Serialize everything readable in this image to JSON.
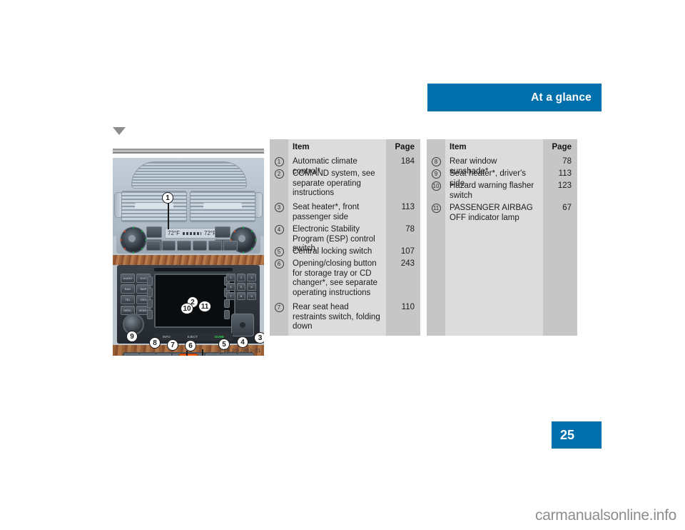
{
  "header": {
    "section_title": "At a glance"
  },
  "page_number": "25",
  "figure": {
    "caption": "P68.20-2851-31",
    "marker": "down-triangle",
    "climate_display_left": "72°F",
    "climate_display_right": "72°F",
    "comand_buttons_left": [
      "AUDIO",
      "RAD",
      "TEL",
      "SEEK-"
    ],
    "comand_buttons_left2": [
      "EXIT",
      "MAP",
      "GEO",
      "SEEK+"
    ],
    "comand_keypad": [
      "1",
      "2",
      "3",
      "4",
      "5",
      "6",
      "7",
      "8",
      "9"
    ],
    "comand_bottom_labels": [
      "INFO",
      "R",
      "EJECT"
    ],
    "comand_bottom_green": "DONE",
    "callouts": [
      "1",
      "2",
      "3",
      "4",
      "5",
      "6",
      "7",
      "8",
      "9",
      "10",
      "11"
    ]
  },
  "tables": [
    {
      "id": "left-table",
      "headers": {
        "num": "",
        "item": "Item",
        "page": "Page"
      },
      "rows": [
        {
          "num": "1",
          "item": "Automatic climate control*",
          "page": "184"
        },
        {
          "num": "2",
          "item": "COMAND system, see separate operating instructions",
          "page": ""
        },
        {
          "num": "3",
          "item": "Seat heater*, front passenger side",
          "page": "113"
        },
        {
          "num": "4",
          "item": "Electronic Stability Program (ESP) control switch",
          "page": "78"
        },
        {
          "num": "5",
          "item": "Central locking switch",
          "page": "107"
        },
        {
          "num": "6",
          "item": "Opening/closing button for storage tray or CD changer*, see separate operating instructions",
          "page": "243"
        },
        {
          "num": "7",
          "item": "Rear seat head restraints switch, folding down",
          "page": "110"
        }
      ]
    },
    {
      "id": "right-table",
      "headers": {
        "num": "",
        "item": "Item",
        "page": "Page"
      },
      "rows": [
        {
          "num": "8",
          "item": "Rear window sunshade*",
          "page": "78"
        },
        {
          "num": "9",
          "item": "Seat heater*, driver's side",
          "page": "113"
        },
        {
          "num": "10",
          "item": "Hazard warning flasher switch",
          "page": "123"
        },
        {
          "num": "11",
          "item": "PASSENGER AIRBAG OFF indicator lamp",
          "page": "67"
        }
      ]
    }
  ],
  "watermark": "carmanualsonline.info",
  "colors": {
    "accent_blue": "#0070ad",
    "table_num_col": "#c6c6c6",
    "table_item_col": "#dcdcdc",
    "page_background": "#ffffff",
    "canvas_background": "#000000"
  }
}
